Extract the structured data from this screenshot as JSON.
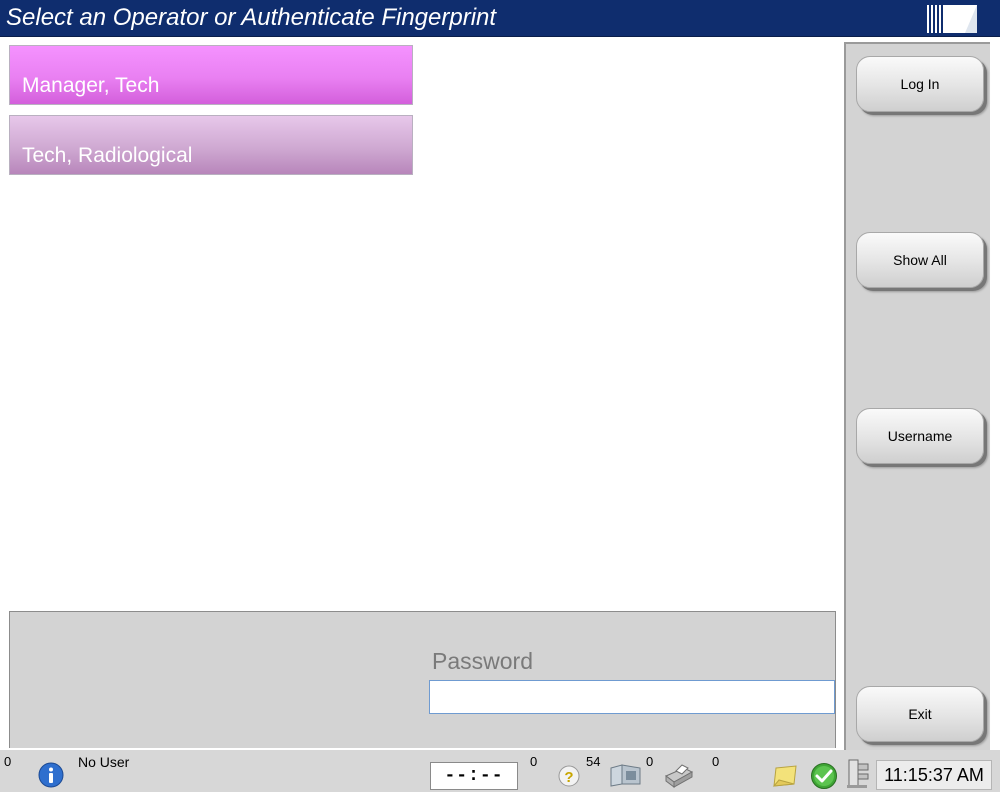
{
  "title": "Select an Operator or Authenticate Fingerprint",
  "operators": [
    {
      "name": "Manager, Tech"
    },
    {
      "name": "Tech, Radiological"
    }
  ],
  "buttons": {
    "login": "Log In",
    "show_all": "Show All",
    "username": "Username",
    "exit": "Exit"
  },
  "password": {
    "label": "Password",
    "value": "",
    "placeholder": ""
  },
  "status_bar": {
    "alerts_count": "0",
    "user": "No User",
    "timer": "--:--",
    "help_count": "0",
    "queue_count": "54",
    "print_count": "0",
    "output_count": "0",
    "clock": "11:15:37 AM",
    "icons": [
      "info-icon",
      "help-icon",
      "image-queue-icon",
      "print-icon",
      "notes-icon",
      "check-status-icon",
      "tube-status-icon"
    ]
  },
  "colors": {
    "title_bar": "#0f2d6e",
    "operator_selected": "#e980f2",
    "operator_normal": "#cfa9d2",
    "panel_bg": "#d3d3d3",
    "status_ok": "#3fa535"
  }
}
